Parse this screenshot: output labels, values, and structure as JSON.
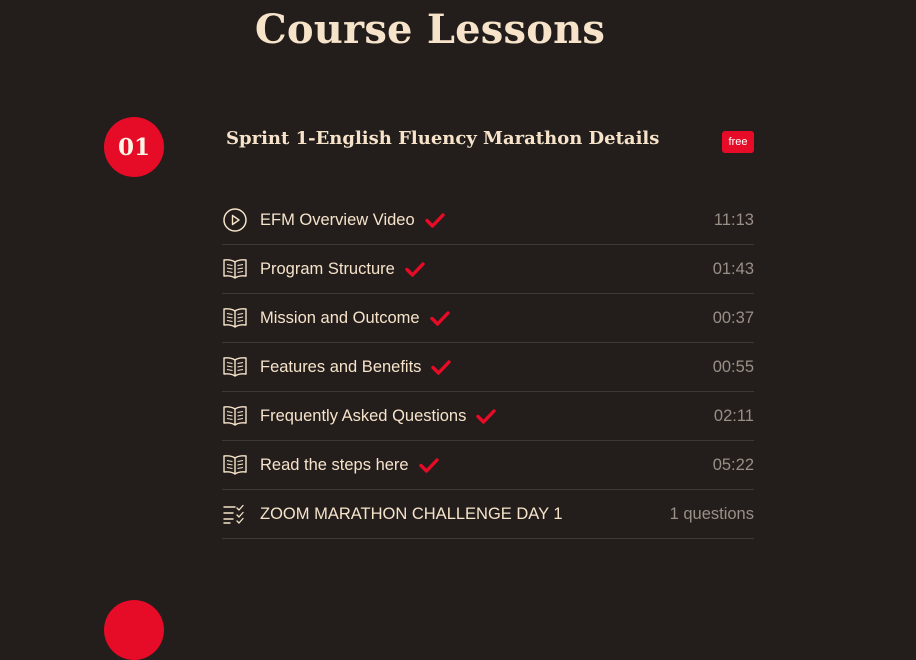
{
  "page": {
    "title": "Course Lessons"
  },
  "colors": {
    "background": "#231e1c",
    "accent": "#e60b26",
    "text": "#f6e3ca",
    "muted": "#9a8f86"
  },
  "section": {
    "number": "01",
    "title": "Sprint 1-English Fluency Marathon Details",
    "badge": "free",
    "lessons": [
      {
        "icon": "play-circle-icon",
        "title": "EFM Overview Video",
        "completed": true,
        "meta": "11:13"
      },
      {
        "icon": "book-icon",
        "title": "Program Structure",
        "completed": true,
        "meta": "01:43"
      },
      {
        "icon": "book-icon",
        "title": "Mission and Outcome",
        "completed": true,
        "meta": "00:37"
      },
      {
        "icon": "book-icon",
        "title": "Features and Benefits",
        "completed": true,
        "meta": "00:55"
      },
      {
        "icon": "book-icon",
        "title": "Frequently Asked Questions",
        "completed": true,
        "meta": "02:11"
      },
      {
        "icon": "book-icon",
        "title": "Read the steps here",
        "completed": true,
        "meta": "05:22"
      },
      {
        "icon": "quiz-list-icon",
        "title": "ZOOM MARATHON CHALLENGE DAY 1",
        "completed": false,
        "meta": "1 questions"
      }
    ]
  }
}
